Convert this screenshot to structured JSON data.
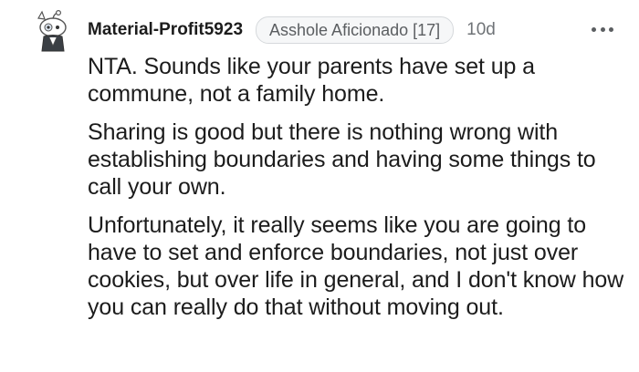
{
  "comment": {
    "username": "Material-Profit5923",
    "flair": "Asshole Aficionado [17]",
    "age": "10d",
    "more_icon": "more-horizontal-icon",
    "avatar_icon": "snoo-avatar-icon",
    "paragraphs": [
      "NTA. Sounds like your parents have set up a commune, not a family home.",
      "Sharing is good but there is nothing wrong with establishing boundaries and having some things to call your own.",
      "Unfortunately, it really seems like you are going to have to set and enforce boundaries, not just over cookies, but over life in general, and I don't know how you can really do that without moving out."
    ]
  },
  "colors": {
    "text": "#1c1c1c",
    "meta": "#6f7377",
    "flair_bg": "#f6f7f8",
    "flair_border": "#d6d9dc"
  }
}
